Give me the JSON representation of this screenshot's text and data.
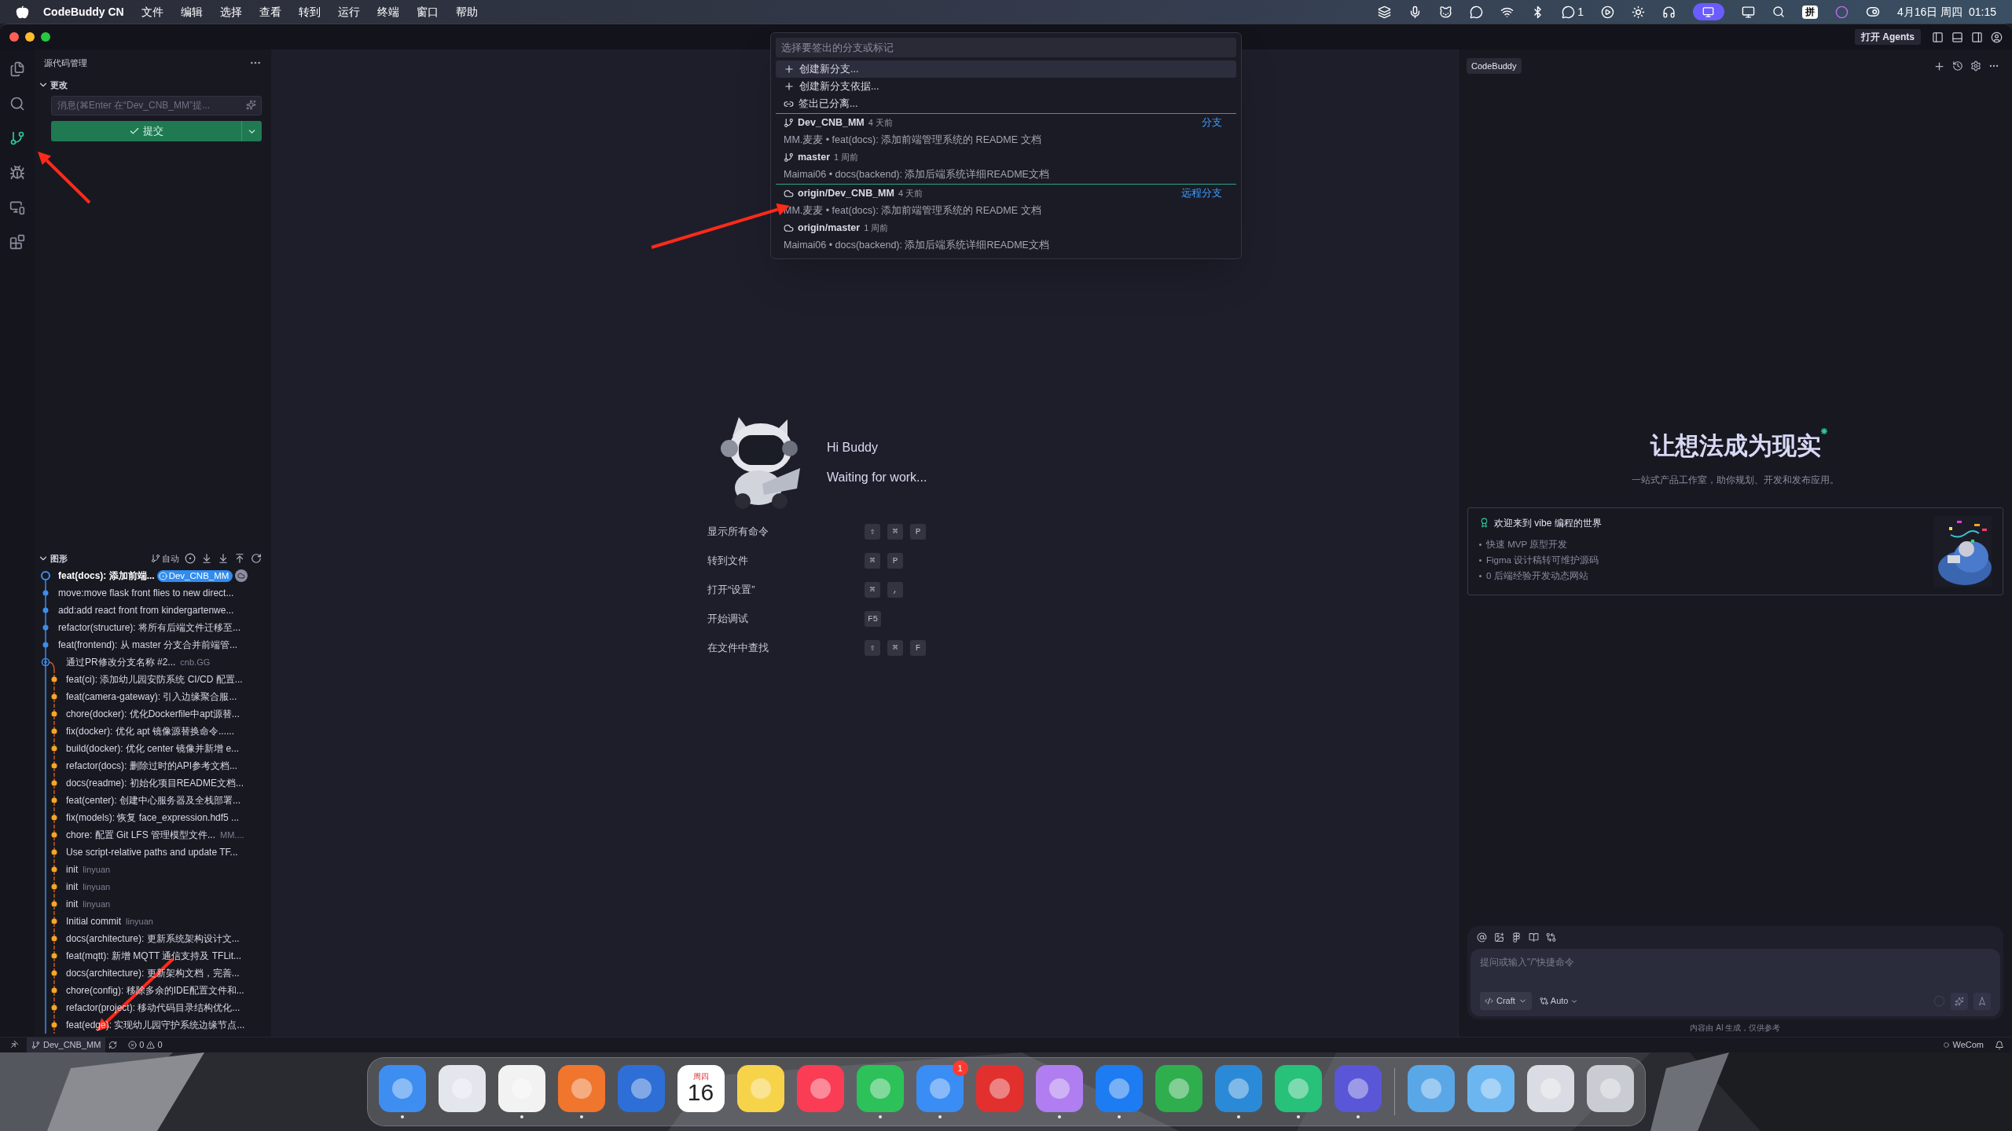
{
  "menu_bar": {
    "app_name": "CodeBuddy CN",
    "menus": [
      "文件",
      "编辑",
      "选择",
      "查看",
      "转到",
      "运行",
      "终端",
      "窗口",
      "帮助"
    ],
    "notification_count": "1",
    "input_method": "拼",
    "clock": "4月16日 周四  01:15"
  },
  "title_bar": {
    "agents_button": "打开 Agents"
  },
  "activity_bar": [
    {
      "kind": "files",
      "selected": false
    },
    {
      "kind": "search",
      "selected": false
    },
    {
      "kind": "scm",
      "selected": true
    },
    {
      "kind": "debug",
      "selected": false
    },
    {
      "kind": "remote",
      "selected": false
    },
    {
      "kind": "extensions",
      "selected": false
    }
  ],
  "source_control": {
    "title": "源代码管理",
    "changes_label": "更改",
    "changes_expanded": true,
    "message_placeholder": "消息(⌘Enter 在“Dev_CNB_MM”提...",
    "commit_button": "提交"
  },
  "graph": {
    "title": "图形",
    "expanded": true,
    "auto_label": "自动",
    "commits": [
      {
        "kind": "head",
        "color": "#3b8eea",
        "message": "feat(docs): 添加前端...",
        "tag": "Dev_CNB_MM"
      },
      {
        "kind": "commit",
        "color": "#3b8eea",
        "message": "move:move flask front flies to new direct..."
      },
      {
        "kind": "commit",
        "color": "#3b8eea",
        "message": "add:add react front from kindergartenwe..."
      },
      {
        "kind": "commit",
        "color": "#3b8eea",
        "message": "refactor(structure): 将所有后端文件迁移至..."
      },
      {
        "kind": "commit",
        "color": "#3b8eea",
        "message": "feat(frontend): 从 master 分支合并前端管..."
      },
      {
        "kind": "merge",
        "color": "#3b8eea",
        "message": "通过PR修改分支名称 #2...",
        "author": "cnb.GG"
      },
      {
        "kind": "side",
        "color": "#f5a623",
        "message": "feat(ci): 添加幼儿园安防系统 CI/CD 配置..."
      },
      {
        "kind": "side",
        "color": "#f5a623",
        "message": "feat(camera-gateway): 引入边缘聚合服..."
      },
      {
        "kind": "side",
        "color": "#f5a623",
        "message": "chore(docker): 优化Dockerfile中apt源替..."
      },
      {
        "kind": "side",
        "color": "#f5a623",
        "message": "fix(docker): 优化 apt 镜像源替换命令......"
      },
      {
        "kind": "side",
        "color": "#f5a623",
        "message": "build(docker): 优化 center 镜像并新增 e..."
      },
      {
        "kind": "side",
        "color": "#f5a623",
        "message": "refactor(docs): 删除过时的API参考文档..."
      },
      {
        "kind": "side",
        "color": "#f5a623",
        "message": "docs(readme): 初始化项目README文档..."
      },
      {
        "kind": "side",
        "color": "#f5a623",
        "message": "feat(center): 创建中心服务器及全栈部署..."
      },
      {
        "kind": "side",
        "color": "#f5a623",
        "message": "fix(models): 恢复 face_expression.hdf5 ..."
      },
      {
        "kind": "side",
        "color": "#f5a623",
        "message": "chore: 配置 Git LFS 管理模型文件...",
        "author": "MM...."
      },
      {
        "kind": "side",
        "color": "#f5a623",
        "message": "Use script-relative paths and update TF..."
      },
      {
        "kind": "side",
        "color": "#f5a623",
        "message": "init",
        "author": "linyuan"
      },
      {
        "kind": "side",
        "color": "#f5a623",
        "message": "init",
        "author": "linyuan"
      },
      {
        "kind": "side",
        "color": "#f5a623",
        "message": "init",
        "author": "linyuan"
      },
      {
        "kind": "side",
        "color": "#f5a623",
        "message": "Initial commit",
        "author": "linyuan"
      },
      {
        "kind": "side",
        "color": "#f5a623",
        "message": "docs(architecture): 更新系统架构设计文..."
      },
      {
        "kind": "side",
        "color": "#f5a623",
        "message": "feat(mqtt): 新增 MQTT 通信支持及 TFLit..."
      },
      {
        "kind": "side",
        "color": "#f5a623",
        "message": "docs(architecture): 更新架构文档，完善..."
      },
      {
        "kind": "side",
        "color": "#f5a623",
        "message": "chore(config): 移除多余的IDE配置文件和..."
      },
      {
        "kind": "side",
        "color": "#f5a623",
        "message": "refactor(project): 移动代码目录结构优化..."
      },
      {
        "kind": "side",
        "color": "#f5a623",
        "message": "feat(edge): 实现幼儿园守护系统边缘节点..."
      }
    ]
  },
  "quick_pick": {
    "placeholder": "选择要签出的分支或标记",
    "actions": [
      {
        "kind": "create",
        "label": "创建新分支...",
        "selected": true
      },
      {
        "kind": "create",
        "label": "创建新分支依据...",
        "selected": false
      },
      {
        "kind": "detach",
        "label": "签出已分离...",
        "selected": false
      }
    ],
    "groups": [
      {
        "label": "分支",
        "items": [
          {
            "kind": "local",
            "name": "Dev_CNB_MM",
            "age": "4 天前",
            "detail": "MM.麦麦 • feat(docs): 添加前端管理系统的 README 文档",
            "selected": false
          },
          {
            "kind": "local",
            "name": "master",
            "age": "1 周前",
            "detail": "Maimai06 • docs(backend): 添加后端系统详细README文档",
            "selected": false
          }
        ]
      },
      {
        "label": "远程分支",
        "items": [
          {
            "kind": "remote",
            "name": "origin/Dev_CNB_MM",
            "age": "4 天前",
            "detail": "MM.麦麦 • feat(docs): 添加前端管理系统的 README 文档",
            "selected": false
          },
          {
            "kind": "remote",
            "name": "origin/master",
            "age": "1 周前",
            "detail": "Maimai06 • docs(backend): 添加后端系统详细README文档",
            "selected": false
          }
        ]
      }
    ]
  },
  "welcome": {
    "greeting": "Hi Buddy",
    "status": "Waiting for work...",
    "shortcuts": [
      {
        "label": "显示所有命令",
        "keys": [
          "⇧",
          "⌘",
          "P"
        ]
      },
      {
        "label": "转到文件",
        "keys": [
          "⌘",
          "P"
        ]
      },
      {
        "label": "打开“设置”",
        "keys": [
          "⌘",
          ","
        ]
      },
      {
        "label": "开始调试",
        "keys": [
          "F5"
        ]
      },
      {
        "label": "在文件中查找",
        "keys": [
          "⇧",
          "⌘",
          "F"
        ]
      }
    ]
  },
  "codebuddy_panel": {
    "tab": "CodeBuddy",
    "headline": "让想法成为现实",
    "tagline": "一站式产品工作室，助你规划、开发和发布应用。",
    "card": {
      "title": "欢迎来到 vibe 编程的世界",
      "bullets": [
        "快速 MVP 原型开发",
        "Figma 设计稿转可维护源码",
        "0 后端经验开发动态网站"
      ]
    },
    "input_placeholder": "提问或输入\"/\"快捷命令",
    "mode": "Craft",
    "model": "Auto",
    "disclaimer": "内容由 AI 生成，仅供参考"
  },
  "status_bar": {
    "branch": "Dev_CNB_MM",
    "errors": "0",
    "warnings": "0",
    "account": "WeCom"
  },
  "dock": {
    "apps": [
      {
        "kind": "app",
        "color": "#3d8ef0",
        "running": true
      },
      {
        "kind": "app",
        "color": "#e4e6ee",
        "running": false
      },
      {
        "kind": "app",
        "color": "#f2f2f2",
        "running": true
      },
      {
        "kind": "app",
        "color": "#f0752d",
        "running": true
      },
      {
        "kind": "app",
        "color": "#2d6fd6",
        "running": false
      },
      {
        "kind": "calendar",
        "weekday": "周四",
        "day": "16",
        "running": false
      },
      {
        "kind": "app",
        "color": "#f7d34a",
        "running": false
      },
      {
        "kind": "app",
        "color": "#fa3c55",
        "running": false
      },
      {
        "kind": "app",
        "color": "#2dc15a",
        "running": true
      },
      {
        "kind": "app",
        "color": "#3a8df5",
        "running": true,
        "badge": "1"
      },
      {
        "kind": "app",
        "color": "#e2302f",
        "running": false
      },
      {
        "kind": "app",
        "color": "#b07ef0",
        "running": true
      },
      {
        "kind": "app",
        "color": "#1d7cf2",
        "running": true
      },
      {
        "kind": "app",
        "color": "#2fae4d",
        "running": false
      },
      {
        "kind": "app",
        "color": "#2a8ad8",
        "running": true
      },
      {
        "kind": "app",
        "color": "#27c17a",
        "running": true
      },
      {
        "kind": "app",
        "color": "#5a56d8",
        "running": true
      },
      {
        "kind": "divider"
      },
      {
        "kind": "app",
        "color": "#5aa7e8",
        "running": false
      },
      {
        "kind": "app",
        "color": "#6bb6f0",
        "running": false
      },
      {
        "kind": "app",
        "color": "#d9dce3",
        "running": false
      },
      {
        "kind": "app",
        "color": "#c9ccd2",
        "running": false
      }
    ]
  }
}
